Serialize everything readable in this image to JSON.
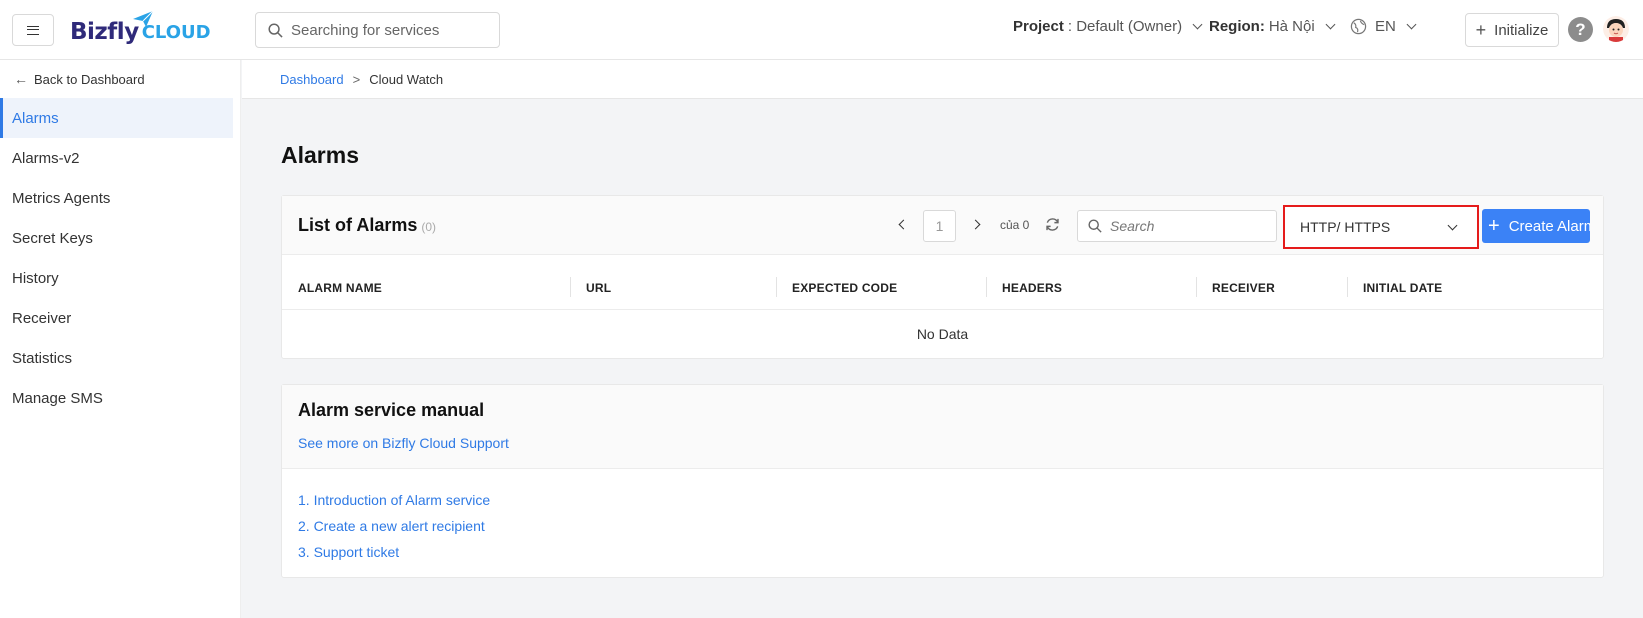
{
  "header": {
    "logo_text": "Bizfly",
    "logo_sub": "CLOUD",
    "search_placeholder": "Searching for services",
    "project_label": "Project",
    "project_value": ": Default (Owner)",
    "region_label": "Region:",
    "region_value": "Hà Nội",
    "language": "EN",
    "initialize_label": "Initialize",
    "help_glyph": "?"
  },
  "sidebar": {
    "back_label": "Back to Dashboard",
    "items": [
      {
        "label": "Alarms",
        "active": true
      },
      {
        "label": "Alarms-v2"
      },
      {
        "label": "Metrics Agents"
      },
      {
        "label": "Secret Keys"
      },
      {
        "label": "History"
      },
      {
        "label": "Receiver"
      },
      {
        "label": "Statistics"
      },
      {
        "label": "Manage SMS"
      }
    ]
  },
  "breadcrumb": {
    "root": "Dashboard",
    "separator": ">",
    "current": "Cloud Watch"
  },
  "page": {
    "title": "Alarms"
  },
  "alarms_list": {
    "title": "List of Alarms",
    "count": "(0)",
    "page_number": "1",
    "total_pages": "của 0",
    "search_placeholder": "Search",
    "type_selected": "HTTP/ HTTPS",
    "create_label": "Create Alarm",
    "columns": [
      "ALARM NAME",
      "URL",
      "EXPECTED CODE",
      "HEADERS",
      "RECEIVER",
      "INITIAL DATE"
    ],
    "empty_text": "No Data"
  },
  "manual": {
    "title": "Alarm service manual",
    "support_link": "See more on Bizfly Cloud Support",
    "items": [
      "1. Introduction of Alarm service",
      "2. Create a new alert recipient",
      "3. Support ticket"
    ]
  },
  "colors": {
    "accent": "#2f7ae5",
    "primary_button": "#3b82f6",
    "highlight_border": "#e51b1b"
  }
}
